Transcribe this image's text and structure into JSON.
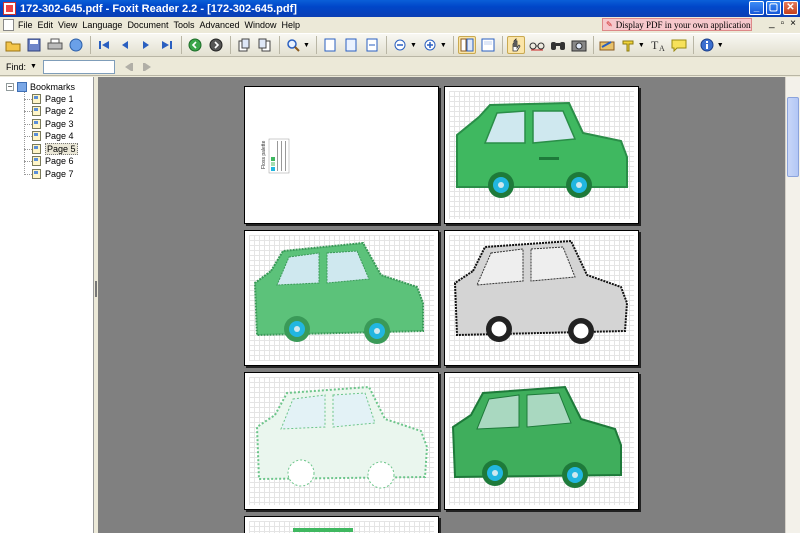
{
  "window": {
    "title": "172-302-645.pdf - Foxit Reader 2.2 - [172-302-645.pdf]",
    "minimize": "_",
    "maximize": "▢",
    "close": "✕"
  },
  "menu": {
    "items": [
      "File",
      "Edit",
      "View",
      "Language",
      "Document",
      "Tools",
      "Advanced",
      "Window",
      "Help"
    ],
    "promo": "Display PDF in your own applications",
    "mdi": [
      "_",
      "▫",
      "×"
    ]
  },
  "toolbar": {
    "icons": [
      "open-icon",
      "save-icon",
      "print-icon",
      "email-icon",
      "first-page-icon",
      "prev-page-icon",
      "next-page-icon",
      "last-page-icon",
      "go-back-icon",
      "go-forward-icon",
      "rotate-left-icon",
      "rotate-right-icon",
      "zoom-icon",
      "actual-size-icon",
      "fit-page-icon",
      "fit-width-icon",
      "zoom-out-icon",
      "zoom-in-icon",
      "single-page-icon",
      "continuous-icon",
      "hand-tool-icon",
      "select-text-icon",
      "find-icon",
      "snapshot-icon",
      "pen-icon",
      "highlight-icon",
      "typewriter-icon",
      "note-icon",
      "info-icon"
    ]
  },
  "findbar": {
    "label": "Find:",
    "value": "",
    "placeholder": ""
  },
  "bookmarks": {
    "root": "Bookmarks",
    "selected_index": 4,
    "items": [
      "Page 1",
      "Page 2",
      "Page 3",
      "Page 4",
      "Page 5",
      "Page 6",
      "Page 7"
    ]
  },
  "page1": {
    "palette_title": "Floss palette"
  },
  "colors": {
    "car_green": "#3fb860",
    "car_light_green": "#a6dcaf",
    "window_blue": "#cfe8ef",
    "wheel_blue": "#22b6e0",
    "dark_green": "#1e7a3a"
  }
}
